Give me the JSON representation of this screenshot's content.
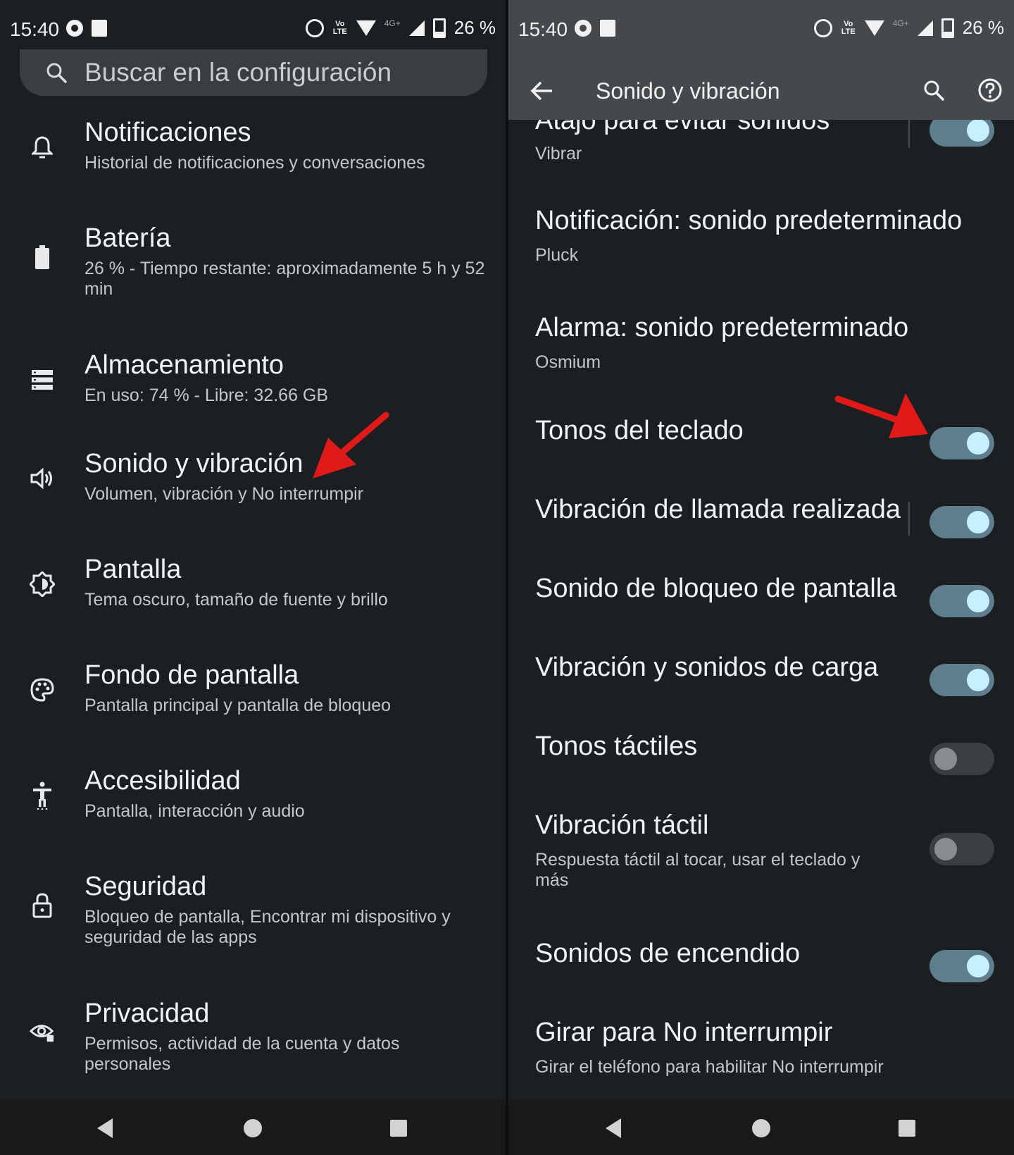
{
  "status_bar": {
    "time": "15:40",
    "battery_text": "26 %",
    "network_label": "4G+",
    "volte_label": "Vo LTE"
  },
  "left": {
    "search": {
      "placeholder": "Buscar en la configuración"
    },
    "items": [
      {
        "title": "Notificaciones",
        "subtitle": "Historial de notificaciones y conversaciones",
        "icon": "bell-icon"
      },
      {
        "title": "Batería",
        "subtitle": "26 % - Tiempo restante: aproximadamente 5 h y 52 min",
        "icon": "battery-icon"
      },
      {
        "title": "Almacenamiento",
        "subtitle": "En uso: 74 % - Libre: 32.66 GB",
        "icon": "storage-icon"
      },
      {
        "title": "Sonido y vibración",
        "subtitle": "Volumen, vibración y No interrumpir",
        "icon": "volume-icon"
      },
      {
        "title": "Pantalla",
        "subtitle": "Tema oscuro, tamaño de fuente y brillo",
        "icon": "brightness-icon"
      },
      {
        "title": "Fondo de pantalla",
        "subtitle": "Pantalla principal y pantalla de bloqueo",
        "icon": "palette-icon"
      },
      {
        "title": "Accesibilidad",
        "subtitle": "Pantalla, interacción y audio",
        "icon": "accessibility-icon"
      },
      {
        "title": "Seguridad",
        "subtitle": "Bloqueo de pantalla, Encontrar mi dispositivo y seguridad de las apps",
        "icon": "lock-icon"
      },
      {
        "title": "Privacidad",
        "subtitle": "Permisos, actividad de la cuenta y datos personales",
        "icon": "privacy-eye-icon"
      }
    ]
  },
  "right": {
    "appbar_title": "Sonido y vibración",
    "rows": [
      {
        "title": "Atajo para evitar sonidos",
        "subtitle": "Vibrar",
        "on": true
      },
      {
        "title": "Notificación: sonido predeterminado",
        "subtitle": "Pluck"
      },
      {
        "title": "Alarma: sonido predeterminado",
        "subtitle": "Osmium"
      },
      {
        "title": "Tonos del teclado",
        "on": true
      },
      {
        "title": "Vibración de llamada realizada",
        "on": true
      },
      {
        "title": "Sonido de bloqueo de pantalla",
        "on": true
      },
      {
        "title": "Vibración y sonidos de carga",
        "on": true
      },
      {
        "title": "Tonos táctiles",
        "on": false
      },
      {
        "title": "Vibración táctil",
        "subtitle": "Respuesta táctil al tocar, usar el teclado y más",
        "on": false
      },
      {
        "title": "Sonidos de encendido",
        "on": true
      },
      {
        "title": "Girar para No interrumpir",
        "subtitle": "Girar el teléfono para habilitar No interrumpir"
      }
    ]
  },
  "colors": {
    "background": "#1c1f22",
    "toggle_on_track": "#5f7e8c",
    "toggle_on_knob": "#c6f0ff",
    "annotation_arrow": "#e01919"
  }
}
